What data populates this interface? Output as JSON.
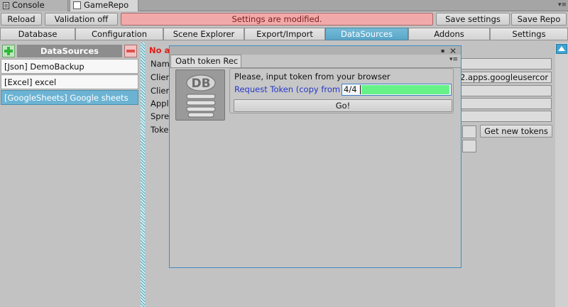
{
  "window_tabs": [
    {
      "label": "Console",
      "icon": "console-icon"
    },
    {
      "label": "GameRepo",
      "icon": "window-icon"
    }
  ],
  "toolbar": {
    "reload": "Reload",
    "validation": "Validation off",
    "modified": "Settings are modified.",
    "save_settings": "Save settings",
    "save_repo": "Save Repo"
  },
  "main_tabs": [
    {
      "label": "Database"
    },
    {
      "label": "Configuration"
    },
    {
      "label": "Scene Explorer"
    },
    {
      "label": "Export/Import"
    },
    {
      "label": "DataSources",
      "active": true
    },
    {
      "label": "Addons"
    },
    {
      "label": "Settings"
    }
  ],
  "datasources": {
    "header": "DataSources",
    "items": [
      {
        "label": "[Json] DemoBackup"
      },
      {
        "label": "[Excel] excel"
      },
      {
        "label": "[GoogleSheets] Google sheets",
        "selected": true
      }
    ]
  },
  "form": {
    "error_text": "No a",
    "labels": [
      "Nam",
      "Clier",
      "Clier",
      "Appl",
      "Spre",
      "Toke"
    ],
    "client_id_tail": "2.apps.googleusercor",
    "get_new_tokens": "Get new tokens"
  },
  "dialog": {
    "tab_title": "Oath token Rec",
    "prompt": "Please, input token from your browser",
    "request_link": "Request Token (copy from",
    "token_value": "4/4",
    "go_button": "Go!",
    "logo_text": "DB"
  },
  "colors": {
    "accent_tab": "#5aa6c8",
    "banner_bg": "#f2a9a9",
    "token_highlight": "#67f288",
    "link": "#2738c7",
    "error": "#e0201a"
  }
}
